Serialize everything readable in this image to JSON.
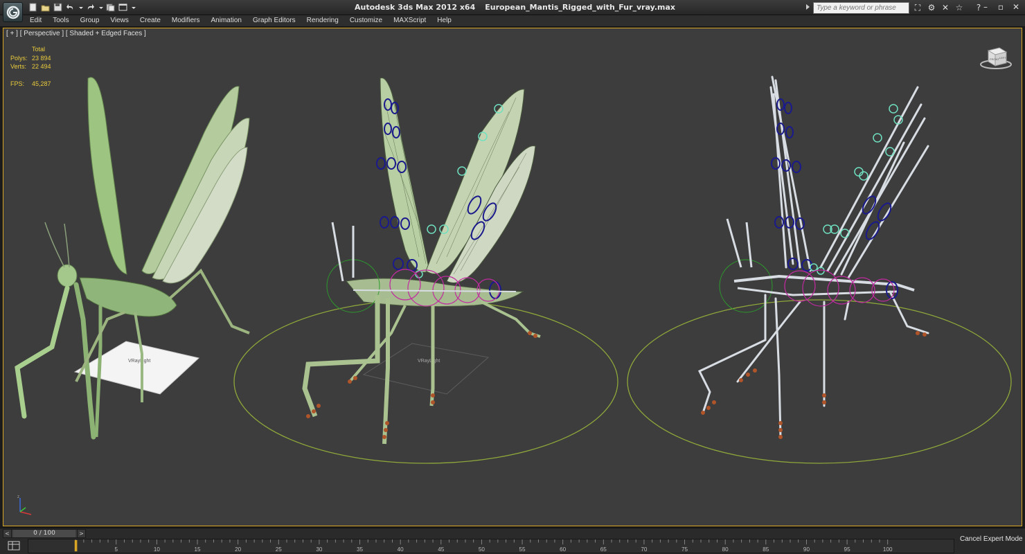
{
  "window": {
    "app_title": "Autodesk 3ds Max  2012 x64",
    "file_name": "European_Mantis_Rigged_with_Fur_vray.max"
  },
  "search": {
    "placeholder": "Type a keyword or phrase"
  },
  "menu": [
    "Edit",
    "Tools",
    "Group",
    "Views",
    "Create",
    "Modifiers",
    "Animation",
    "Graph Editors",
    "Rendering",
    "Customize",
    "MAXScript",
    "Help"
  ],
  "viewport": {
    "label": "[ + ] [ Perspective ] [ Shaded + Edged Faces ]",
    "stats": {
      "header": "Total",
      "polys_label": "Polys:",
      "polys_value": "23 894",
      "verts_label": "Verts:",
      "verts_value": "22 494",
      "fps_label": "FPS:",
      "fps_value": "45,287"
    },
    "scene_labels": [
      "VRayLight",
      "VRayLight"
    ],
    "viewcube_labels": [
      "FRONT",
      "LEFT"
    ]
  },
  "timeline": {
    "frame_display": "0 / 100",
    "prev_label": "<",
    "next_label": ">",
    "ticks": [
      "0",
      "5",
      "10",
      "15",
      "20",
      "25",
      "30",
      "35",
      "40",
      "45",
      "50",
      "55",
      "60",
      "65",
      "70",
      "75",
      "80",
      "85",
      "90",
      "95",
      "100"
    ],
    "current_frame": 0,
    "total_frames": 100
  },
  "status": {
    "cancel_expert_mode": "Cancel Expert Mode"
  },
  "colors": {
    "viewport_bg": "#3d3d3d",
    "viewport_border": "#d8a524",
    "stats_text": "#eacb3c",
    "ground_circle": "#8fa83a",
    "bone_white": "#d8dde4",
    "control_blue": "#1a1a8c",
    "control_cyan": "#6fe0c0",
    "control_magenta": "#c02aa0",
    "mantis_green": "#a6c98a"
  }
}
